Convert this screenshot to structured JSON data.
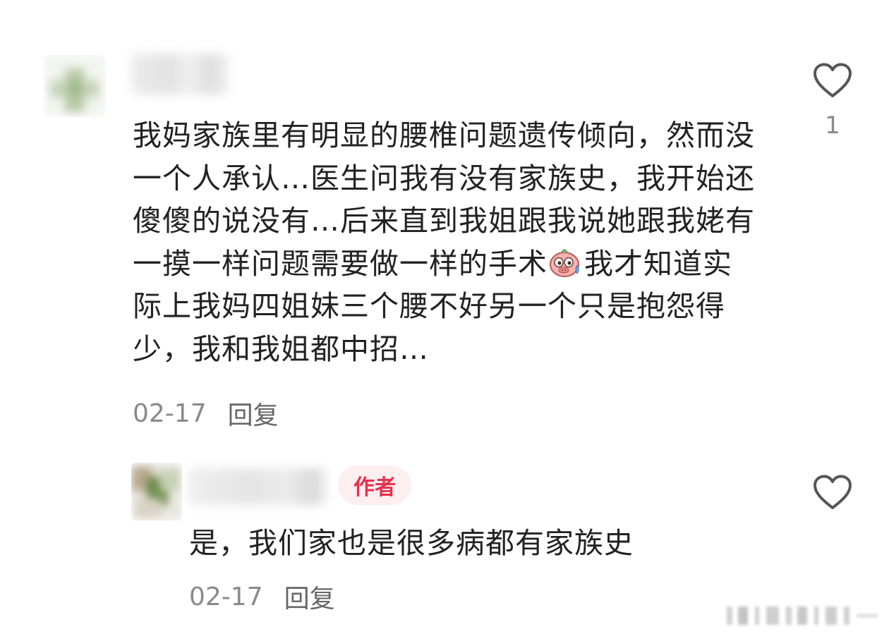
{
  "comments": [
    {
      "text_before_emoji": "我妈家族里有明显的腰椎问题遗传倾向，然而没一个人承认…医生问我有没有家族史，我开始还傻傻的说没有…后来直到我姐跟我说她跟我姥有一摸一样问题需要做一样的手术",
      "emoji": "sweating-pig-emoji",
      "text_after_emoji": "我才知道实际上我妈四姐妹三个腰不好另一个只是抱怨得少，我和我姐都中招…",
      "date": "02-17",
      "reply_label": "回复",
      "like_icon": "heart-outline-icon",
      "like_count": "1"
    },
    {
      "badge_label": "作者",
      "text": "是，我们家也是很多病都有家族史",
      "date": "02-17",
      "reply_label": "回复",
      "like_icon": "heart-outline-icon"
    }
  ],
  "colors": {
    "text": "#222222",
    "meta": "#8a8a8a",
    "badge_text": "#e8304a",
    "badge_bg": "#fdeef0"
  }
}
